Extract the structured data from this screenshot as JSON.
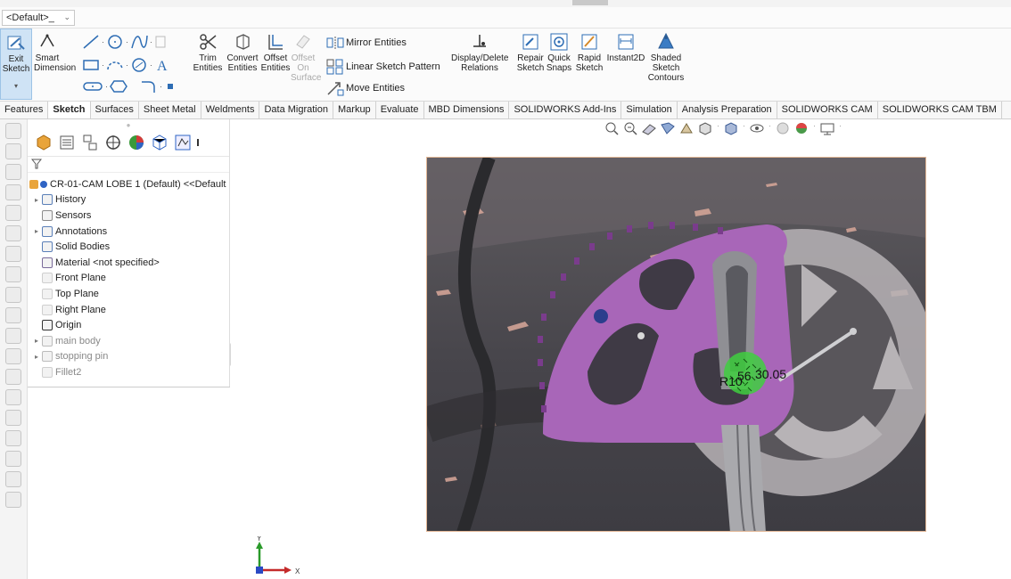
{
  "config": {
    "value": "<Default>_"
  },
  "ribbon": {
    "exit_sketch": "Exit Sketch",
    "smart_dimension": "Smart Dimension",
    "trim_entities": "Trim Entities",
    "convert_entities": "Convert Entities",
    "offset_entities": "Offset Entities",
    "offset_on_surface": "Offset On Surface",
    "mirror_entities": "Mirror Entities",
    "linear_sketch_pattern": "Linear Sketch Pattern",
    "move_entities": "Move Entities",
    "display_delete_relations": "Display/Delete Relations",
    "repair_sketch": "Repair Sketch",
    "quick_snaps": "Quick Snaps",
    "rapid_sketch": "Rapid Sketch",
    "instant2d": "Instant2D",
    "shaded_sketch_contours": "Shaded Sketch Contours"
  },
  "tabs": [
    "Features",
    "Sketch",
    "Surfaces",
    "Sheet Metal",
    "Weldments",
    "Data Migration",
    "Markup",
    "Evaluate",
    "MBD Dimensions",
    "SOLIDWORKS Add-Ins",
    "Simulation",
    "Analysis Preparation",
    "SOLIDWORKS CAM",
    "SOLIDWORKS CAM TBM"
  ],
  "active_tab": "Sketch",
  "tree": {
    "root": "CR-01-CAM LOBE 1 (Default) <<Default",
    "items": [
      {
        "label": "History",
        "expandable": true,
        "dim": false
      },
      {
        "label": "Sensors",
        "expandable": false,
        "dim": false
      },
      {
        "label": "Annotations",
        "expandable": true,
        "dim": false
      },
      {
        "label": "Solid Bodies",
        "expandable": false,
        "dim": false
      },
      {
        "label": "Material <not specified>",
        "expandable": false,
        "dim": false
      },
      {
        "label": "Front Plane",
        "expandable": false,
        "dim": false
      },
      {
        "label": "Top Plane",
        "expandable": false,
        "dim": false
      },
      {
        "label": "Right Plane",
        "expandable": false,
        "dim": false
      },
      {
        "label": "Origin",
        "expandable": false,
        "dim": false
      },
      {
        "label": "main body",
        "expandable": true,
        "dim": true
      },
      {
        "label": "stopping pin",
        "expandable": true,
        "dim": true
      },
      {
        "label": "Fillet2",
        "expandable": false,
        "dim": true
      }
    ]
  },
  "viewport": {
    "dim_r": "R10",
    "dim_value": "30.05",
    "dim_extra": "56",
    "triad_y": "Y",
    "triad_x": "X"
  }
}
